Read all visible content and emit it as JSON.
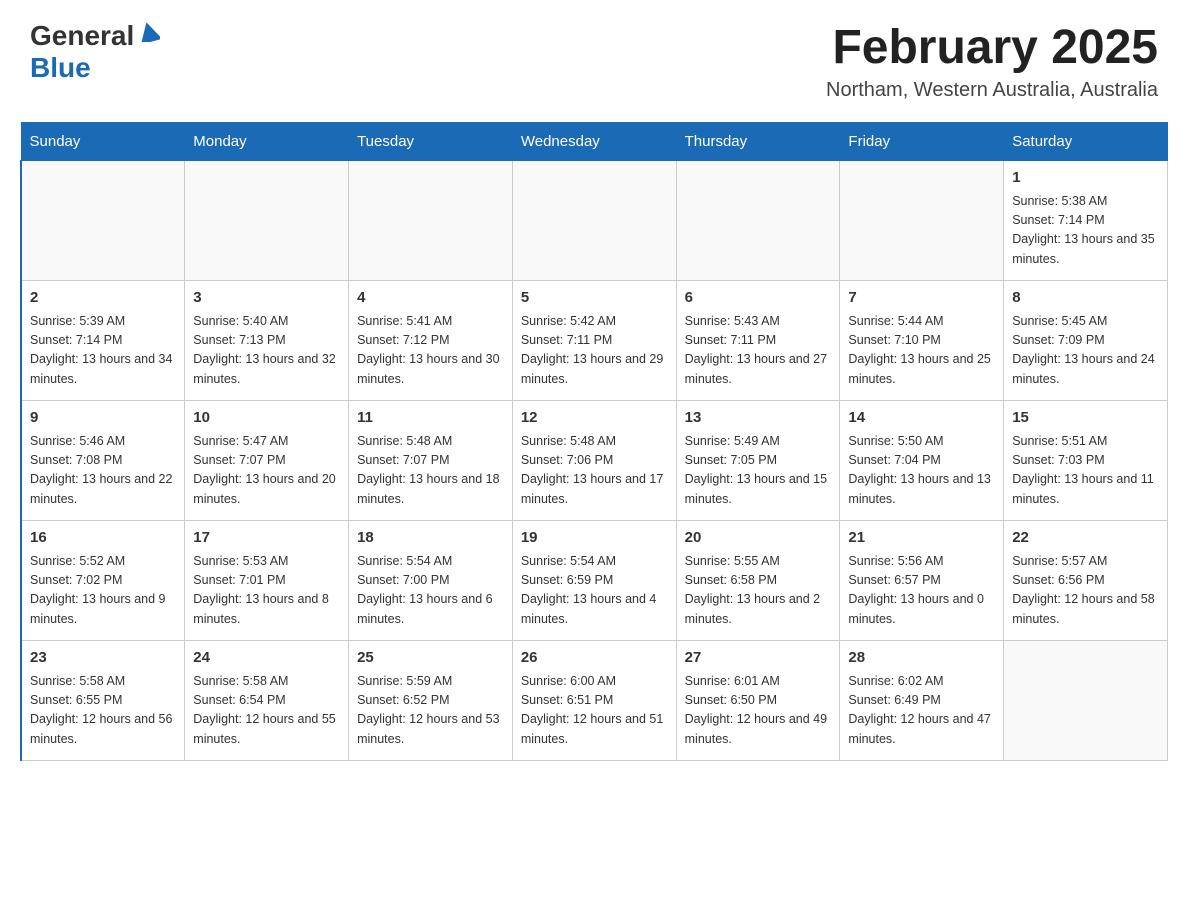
{
  "header": {
    "logo_general": "General",
    "logo_blue": "Blue",
    "title": "February 2025",
    "subtitle": "Northam, Western Australia, Australia"
  },
  "days_of_week": [
    "Sunday",
    "Monday",
    "Tuesday",
    "Wednesday",
    "Thursday",
    "Friday",
    "Saturday"
  ],
  "weeks": [
    [
      {
        "date": "",
        "info": ""
      },
      {
        "date": "",
        "info": ""
      },
      {
        "date": "",
        "info": ""
      },
      {
        "date": "",
        "info": ""
      },
      {
        "date": "",
        "info": ""
      },
      {
        "date": "",
        "info": ""
      },
      {
        "date": "1",
        "info": "Sunrise: 5:38 AM\nSunset: 7:14 PM\nDaylight: 13 hours and 35 minutes."
      }
    ],
    [
      {
        "date": "2",
        "info": "Sunrise: 5:39 AM\nSunset: 7:14 PM\nDaylight: 13 hours and 34 minutes."
      },
      {
        "date": "3",
        "info": "Sunrise: 5:40 AM\nSunset: 7:13 PM\nDaylight: 13 hours and 32 minutes."
      },
      {
        "date": "4",
        "info": "Sunrise: 5:41 AM\nSunset: 7:12 PM\nDaylight: 13 hours and 30 minutes."
      },
      {
        "date": "5",
        "info": "Sunrise: 5:42 AM\nSunset: 7:11 PM\nDaylight: 13 hours and 29 minutes."
      },
      {
        "date": "6",
        "info": "Sunrise: 5:43 AM\nSunset: 7:11 PM\nDaylight: 13 hours and 27 minutes."
      },
      {
        "date": "7",
        "info": "Sunrise: 5:44 AM\nSunset: 7:10 PM\nDaylight: 13 hours and 25 minutes."
      },
      {
        "date": "8",
        "info": "Sunrise: 5:45 AM\nSunset: 7:09 PM\nDaylight: 13 hours and 24 minutes."
      }
    ],
    [
      {
        "date": "9",
        "info": "Sunrise: 5:46 AM\nSunset: 7:08 PM\nDaylight: 13 hours and 22 minutes."
      },
      {
        "date": "10",
        "info": "Sunrise: 5:47 AM\nSunset: 7:07 PM\nDaylight: 13 hours and 20 minutes."
      },
      {
        "date": "11",
        "info": "Sunrise: 5:48 AM\nSunset: 7:07 PM\nDaylight: 13 hours and 18 minutes."
      },
      {
        "date": "12",
        "info": "Sunrise: 5:48 AM\nSunset: 7:06 PM\nDaylight: 13 hours and 17 minutes."
      },
      {
        "date": "13",
        "info": "Sunrise: 5:49 AM\nSunset: 7:05 PM\nDaylight: 13 hours and 15 minutes."
      },
      {
        "date": "14",
        "info": "Sunrise: 5:50 AM\nSunset: 7:04 PM\nDaylight: 13 hours and 13 minutes."
      },
      {
        "date": "15",
        "info": "Sunrise: 5:51 AM\nSunset: 7:03 PM\nDaylight: 13 hours and 11 minutes."
      }
    ],
    [
      {
        "date": "16",
        "info": "Sunrise: 5:52 AM\nSunset: 7:02 PM\nDaylight: 13 hours and 9 minutes."
      },
      {
        "date": "17",
        "info": "Sunrise: 5:53 AM\nSunset: 7:01 PM\nDaylight: 13 hours and 8 minutes."
      },
      {
        "date": "18",
        "info": "Sunrise: 5:54 AM\nSunset: 7:00 PM\nDaylight: 13 hours and 6 minutes."
      },
      {
        "date": "19",
        "info": "Sunrise: 5:54 AM\nSunset: 6:59 PM\nDaylight: 13 hours and 4 minutes."
      },
      {
        "date": "20",
        "info": "Sunrise: 5:55 AM\nSunset: 6:58 PM\nDaylight: 13 hours and 2 minutes."
      },
      {
        "date": "21",
        "info": "Sunrise: 5:56 AM\nSunset: 6:57 PM\nDaylight: 13 hours and 0 minutes."
      },
      {
        "date": "22",
        "info": "Sunrise: 5:57 AM\nSunset: 6:56 PM\nDaylight: 12 hours and 58 minutes."
      }
    ],
    [
      {
        "date": "23",
        "info": "Sunrise: 5:58 AM\nSunset: 6:55 PM\nDaylight: 12 hours and 56 minutes."
      },
      {
        "date": "24",
        "info": "Sunrise: 5:58 AM\nSunset: 6:54 PM\nDaylight: 12 hours and 55 minutes."
      },
      {
        "date": "25",
        "info": "Sunrise: 5:59 AM\nSunset: 6:52 PM\nDaylight: 12 hours and 53 minutes."
      },
      {
        "date": "26",
        "info": "Sunrise: 6:00 AM\nSunset: 6:51 PM\nDaylight: 12 hours and 51 minutes."
      },
      {
        "date": "27",
        "info": "Sunrise: 6:01 AM\nSunset: 6:50 PM\nDaylight: 12 hours and 49 minutes."
      },
      {
        "date": "28",
        "info": "Sunrise: 6:02 AM\nSunset: 6:49 PM\nDaylight: 12 hours and 47 minutes."
      },
      {
        "date": "",
        "info": ""
      }
    ]
  ]
}
